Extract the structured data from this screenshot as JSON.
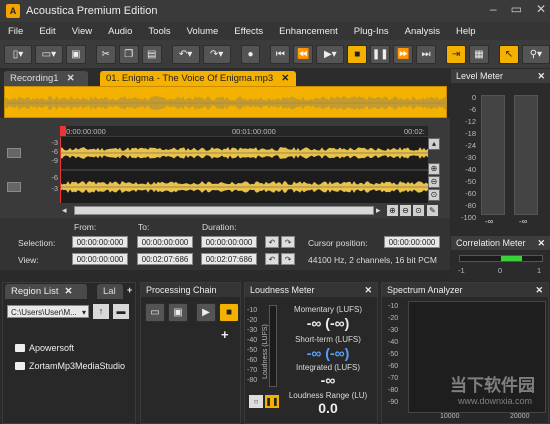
{
  "app": {
    "title": "Acoustica Premium Edition"
  },
  "menu": [
    "File",
    "Edit",
    "View",
    "Audio",
    "Tools",
    "Volume",
    "Effects",
    "Enhancement",
    "Plug-Ins",
    "Analysis",
    "Help"
  ],
  "tabs": [
    {
      "label": "Recording1"
    },
    {
      "label": "01. Enigma - The Voice Of Enigma.mp3"
    }
  ],
  "timeline": {
    "ticks": [
      "00:00:00:000",
      "00:01:00:000",
      "00:02:"
    ]
  },
  "waveform": {
    "scale": [
      "-3",
      "-6",
      "-9",
      "-6",
      "-3"
    ]
  },
  "selection": {
    "from_label": "From:",
    "to_label": "To:",
    "duration_label": "Duration:",
    "selection_label": "Selection:",
    "view_label": "View:",
    "sel_from": "00:00:00:000",
    "sel_to": "00:00:00:000",
    "sel_duration": "00:00:00:000",
    "view_from": "00:00:00:000",
    "view_to": "00:02:07:686",
    "view_duration": "00:02:07:686",
    "cursor_label": "Cursor position:",
    "cursor_value": "00:00:00:000",
    "format": "44100 Hz, 2 channels, 16 bit PCM"
  },
  "level_meter": {
    "title": "Level Meter",
    "scale": [
      "0",
      "-6",
      "-12",
      "-18",
      "-24",
      "-30",
      "-40",
      "-50",
      "-60",
      "-80",
      "-100"
    ],
    "left_value": "-∞",
    "right_value": "-∞"
  },
  "correlation_meter": {
    "title": "Correlation Meter",
    "ticks": [
      "-1",
      "0",
      "1"
    ],
    "value": 0.5
  },
  "region_list": {
    "title": "Region List",
    "tab2": "Lal",
    "path": "C:\\Users\\User\\M...",
    "items": [
      "Apowersoft",
      "ZortamMp3MediaStudio"
    ]
  },
  "processing_chain": {
    "title": "Processing Chain"
  },
  "loudness_meter": {
    "title": "Loudness Meter",
    "scale": [
      "-10",
      "-20",
      "-30",
      "-40",
      "-50",
      "-60",
      "-70",
      "-80"
    ],
    "axis_label": "Loudness (LUFS)",
    "momentary_label": "Momentary (LUFS)",
    "momentary_value": "-∞ (-∞)",
    "shortterm_label": "Short-term (LUFS)",
    "shortterm_value": "-∞ (-∞)",
    "integrated_label": "Integrated (LUFS)",
    "integrated_value": "-∞",
    "range_label": "Loudness Range (LU)",
    "range_value": "0.0"
  },
  "spectrum_analyzer": {
    "title": "Spectrum Analyzer",
    "y_ticks": [
      "-10",
      "-20",
      "-30",
      "-40",
      "-50",
      "-60",
      "-70",
      "-80",
      "-90"
    ],
    "x_ticks": [
      "10000",
      "20000"
    ]
  },
  "watermark": {
    "text1": "当下软件园",
    "text2": "www.downxia.com"
  },
  "colors": {
    "accent": "#f5b100",
    "wave": "#e8c24a",
    "blue_value": "#5aa0ff"
  }
}
